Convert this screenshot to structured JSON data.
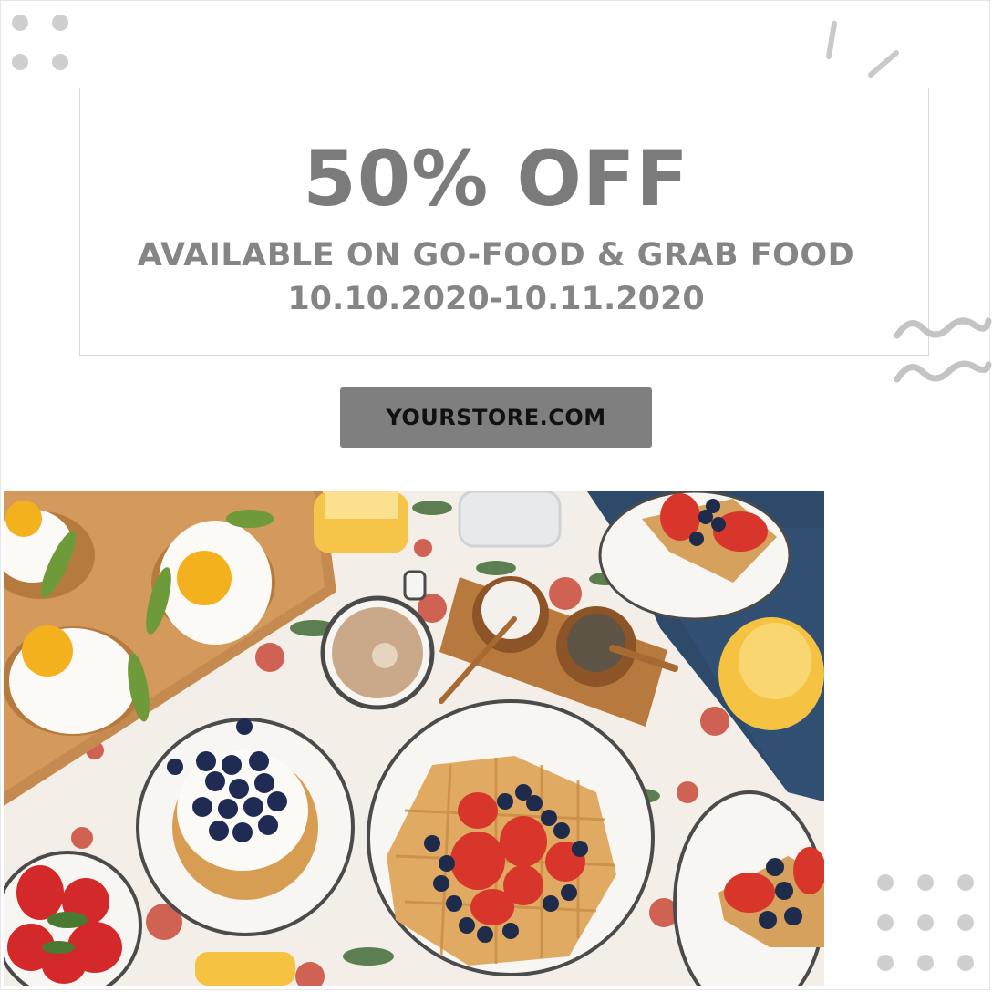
{
  "promo": {
    "headline": "50% OFF",
    "availability": "AVAILABLE ON GO-FOOD & GRAB FOOD",
    "dates": "10.10.2020-10.11.2020",
    "cta_label": "YOURSTORE.COM"
  },
  "photo": {
    "icon": "breakfast-table-photo"
  },
  "colors": {
    "text_gray": "#7b7b7b",
    "button_bg": "#7f7f7f",
    "decor_gray": "#cfcfcf",
    "table_cloth": "#f4efe8",
    "blue_cloth": "#2c4868"
  }
}
